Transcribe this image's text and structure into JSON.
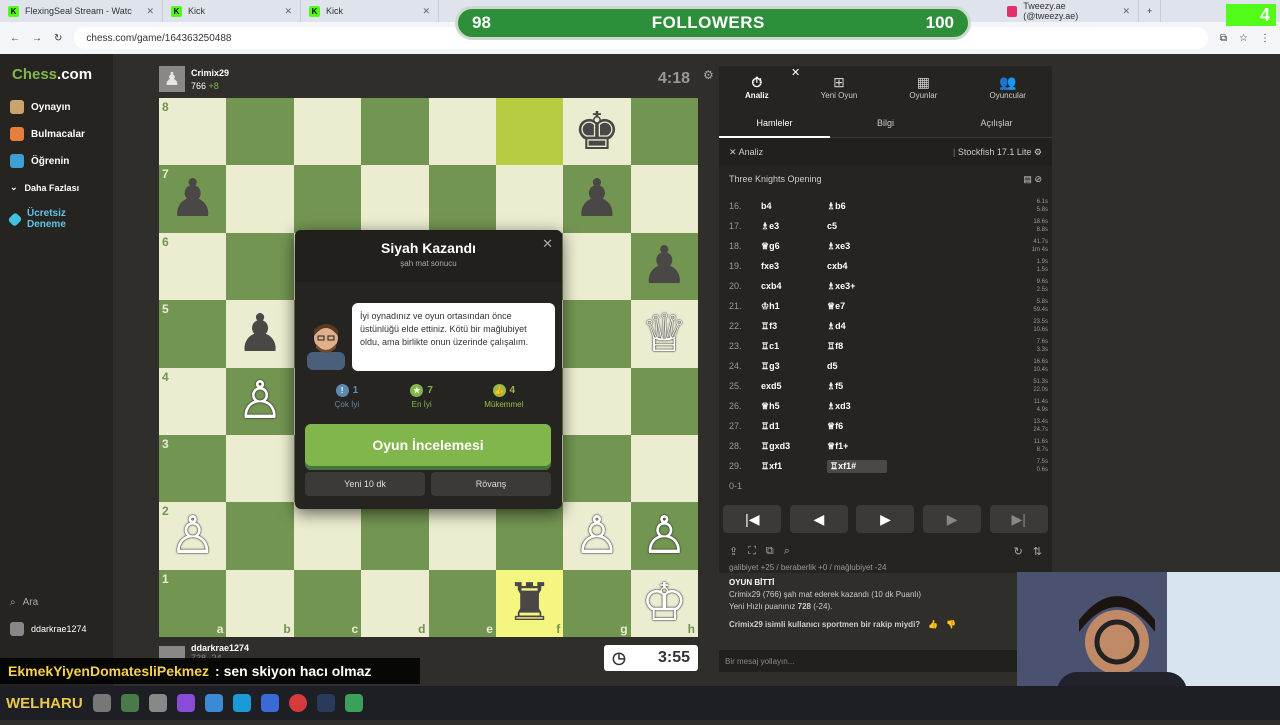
{
  "browser": {
    "tabs": [
      {
        "title": "FlexingSeal Stream - Watc"
      },
      {
        "title": "Kick"
      },
      {
        "title": "Kick"
      },
      {
        "title": "Tweezy.ae (@tweezy.ae)"
      }
    ],
    "url": "chess.com/game/164363250488"
  },
  "followers_widget": {
    "current": "98",
    "label": "FOLLOWERS",
    "goal": "100"
  },
  "kick_badge": "4",
  "sidebar": {
    "logo_a": "Chess",
    "logo_b": ".com",
    "items": [
      {
        "label": "Oynayın"
      },
      {
        "label": "Bulmacalar"
      },
      {
        "label": "Öğrenin"
      },
      {
        "label": "Daha Fazlası"
      },
      {
        "label": "Ücretsiz Deneme"
      }
    ],
    "search": "Ara",
    "user": "ddarkrae1274"
  },
  "top_player": {
    "name": "Crimix29",
    "rating": "766",
    "delta": "+8",
    "clock": "4:18"
  },
  "bottom_player": {
    "name": "ddarkrae1274",
    "rating": "728",
    "delta": "-24",
    "clock": "3:55"
  },
  "board": {
    "ranks": [
      "8",
      "7",
      "6",
      "5",
      "4",
      "3",
      "2",
      "1"
    ],
    "files": [
      "a",
      "b",
      "c",
      "d",
      "e",
      "f",
      "g",
      "h"
    ],
    "pieces": [
      {
        "sq": "g8",
        "piece": "♚",
        "color": "b"
      },
      {
        "sq": "a7",
        "piece": "♟",
        "color": "b"
      },
      {
        "sq": "g7",
        "piece": "♟",
        "color": "b"
      },
      {
        "sq": "h6",
        "piece": "♟",
        "color": "b"
      },
      {
        "sq": "b5",
        "piece": "♟",
        "color": "b"
      },
      {
        "sq": "h5",
        "piece": "♕",
        "color": "w"
      },
      {
        "sq": "b4",
        "piece": "♙",
        "color": "w"
      },
      {
        "sq": "a2",
        "piece": "♙",
        "color": "w"
      },
      {
        "sq": "g2",
        "piece": "♙",
        "color": "w"
      },
      {
        "sq": "h2",
        "piece": "♙",
        "color": "w"
      },
      {
        "sq": "f1",
        "piece": "♜",
        "color": "b"
      },
      {
        "sq": "h1",
        "piece": "♔",
        "color": "w"
      }
    ],
    "highlights": [
      {
        "sq": "f8",
        "type": "hl"
      },
      {
        "sq": "f1",
        "type": "hl2"
      }
    ]
  },
  "modal": {
    "title": "Siyah Kazandı",
    "subtitle": "şah mat sonucu",
    "message": "İyi oynadınız ve oyun ortasından önce üstünlüğü elde ettiniz. Kötü bir mağlubiyet oldu, ama birlikte onun üzerinde çalışalım.",
    "stats": [
      {
        "count": "1",
        "label": "Çok İyi",
        "color": "#5c8bb0"
      },
      {
        "count": "7",
        "label": "En İyi",
        "color": "#81b64c"
      },
      {
        "count": "4",
        "label": "Mükemmel",
        "color": "#96bc4b"
      }
    ],
    "review_label": "Oyun İncelemesi",
    "btn_new": "Yeni 10 dk",
    "btn_rematch": "Rövanş"
  },
  "panel": {
    "tabs": [
      {
        "label": "Analiz",
        "icon": "⏱"
      },
      {
        "label": "Yeni Oyun",
        "icon": "⊞"
      },
      {
        "label": "Oyunlar",
        "icon": "▦"
      },
      {
        "label": "Oyuncular",
        "icon": "👥"
      }
    ],
    "subtabs": [
      "Hamleler",
      "Bilgi",
      "Açılışlar"
    ],
    "analysis_label": "Analiz",
    "engine": "Stockfish 17.1 Lite",
    "opening": "Three Knights Opening",
    "moves": [
      {
        "n": "16.",
        "w": "b4",
        "b": "♗b6",
        "t1": "6.1s",
        "t2": "5.8s"
      },
      {
        "n": "17.",
        "w": "♗e3",
        "b": "c5",
        "t1": "18.6s",
        "t2": "8.8s"
      },
      {
        "n": "18.",
        "w": "♕g6",
        "b": "♗xe3",
        "t1": "41.7s",
        "t2": "1m 4s"
      },
      {
        "n": "19.",
        "w": "fxe3",
        "b": "cxb4",
        "t1": "1.9s",
        "t2": "1.5s"
      },
      {
        "n": "20.",
        "w": "cxb4",
        "b": "♗xe3+",
        "t1": "9.6s",
        "t2": "2.5s"
      },
      {
        "n": "21.",
        "w": "♔h1",
        "b": "♕e7",
        "t1": "5.8s",
        "t2": "59.4s"
      },
      {
        "n": "22.",
        "w": "♖f3",
        "b": "♗d4",
        "t1": "23.5s",
        "t2": "10.6s"
      },
      {
        "n": "23.",
        "w": "♖c1",
        "b": "♖f8",
        "t1": "7.6s",
        "t2": "3.3s"
      },
      {
        "n": "24.",
        "w": "♖g3",
        "b": "d5",
        "t1": "16.6s",
        "t2": "10.4s"
      },
      {
        "n": "25.",
        "w": "exd5",
        "b": "♗f5",
        "t1": "51.3s",
        "t2": "22.0s"
      },
      {
        "n": "26.",
        "w": "♕h5",
        "b": "♗xd3",
        "t1": "11.4s",
        "t2": "4.9s"
      },
      {
        "n": "27.",
        "w": "♖d1",
        "b": "♕f6",
        "t1": "13.4s",
        "t2": "24.7s"
      },
      {
        "n": "28.",
        "w": "♖gxd3",
        "b": "♕f1+",
        "t1": "11.6s",
        "t2": "8.7s"
      },
      {
        "n": "29.",
        "w": "♖xf1",
        "b": "♖xf1#",
        "t1": "7.5s",
        "t2": "0.6s"
      }
    ],
    "result": "0-1",
    "controls": [
      "|◀",
      "◀",
      "▶",
      "▶",
      "▶|"
    ]
  },
  "chat": {
    "line0": "galibiyet +25 / beraberlik +0 / mağlubiyet -24",
    "over": "OYUN BİTTİ",
    "l1": "Crimix29 (766) şah mat ederek kazandı (10 dk Puanlı)",
    "l2a": "Yeni Hızlı puanınız ",
    "l2b": "728",
    "l2c": " (-24).",
    "l3": "Crimix29 isimli kullanıcı sportmen bir rakip miydi?",
    "placeholder": "Bir mesaj yollayın..."
  },
  "stream_overlay": {
    "user": "EkmekYiyenDomatesliPekmez",
    "message": " : sen skiyon hacı olmaz"
  },
  "taskbar_tag": "WELHARU"
}
